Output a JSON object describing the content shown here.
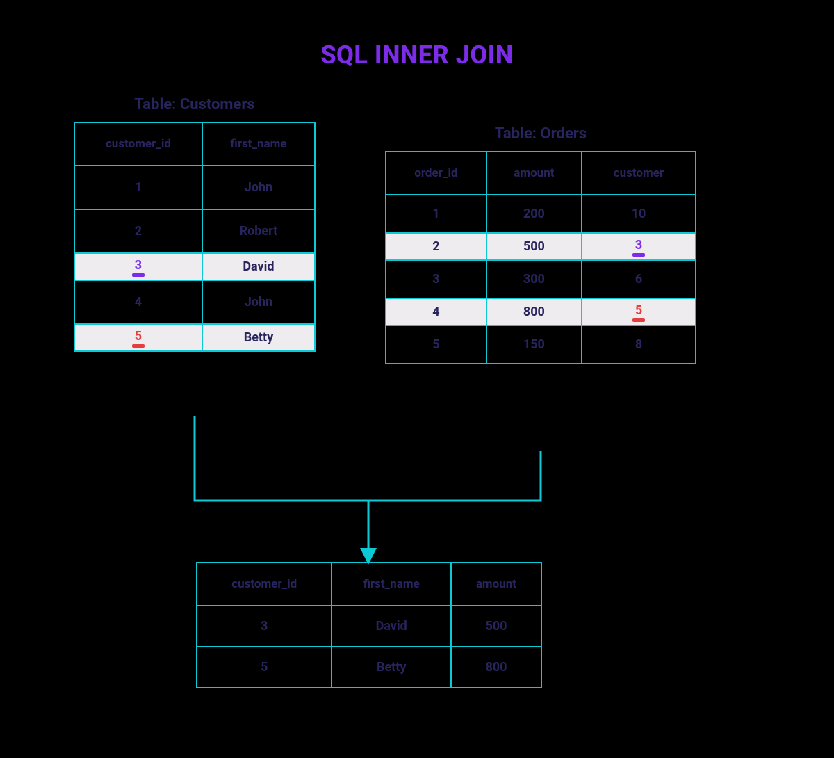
{
  "title": "SQL INNER JOIN",
  "customers": {
    "label": "Table: Customers",
    "headers": [
      "customer_id",
      "first_name"
    ],
    "rows": [
      {
        "cells": [
          "1",
          "John"
        ],
        "highlight": null
      },
      {
        "cells": [
          "2",
          "Robert"
        ],
        "highlight": null
      },
      {
        "cells": [
          "3",
          "David"
        ],
        "highlight": "purple",
        "underline_col": 0
      },
      {
        "cells": [
          "4",
          "John"
        ],
        "highlight": null
      },
      {
        "cells": [
          "5",
          "Betty"
        ],
        "highlight": "red",
        "underline_col": 0
      }
    ]
  },
  "orders": {
    "label": "Table: Orders",
    "headers": [
      "order_id",
      "amount",
      "customer"
    ],
    "rows": [
      {
        "cells": [
          "1",
          "200",
          "10"
        ],
        "highlight": null
      },
      {
        "cells": [
          "2",
          "500",
          "3"
        ],
        "highlight": "purple",
        "underline_col": 2
      },
      {
        "cells": [
          "3",
          "300",
          "6"
        ],
        "highlight": null
      },
      {
        "cells": [
          "4",
          "800",
          "5"
        ],
        "highlight": "red",
        "underline_col": 2
      },
      {
        "cells": [
          "5",
          "150",
          "8"
        ],
        "highlight": null
      }
    ]
  },
  "result": {
    "headers": [
      "customer_id",
      "first_name",
      "amount"
    ],
    "rows": [
      {
        "cells": [
          "3",
          "David",
          "500"
        ]
      },
      {
        "cells": [
          "5",
          "Betty",
          "800"
        ]
      }
    ]
  },
  "colors": {
    "border": "#0cc9d6",
    "text": "#28245e",
    "title": "#7c2ce8",
    "hl_purple": "#7c2ce8",
    "hl_red": "#e53e3e"
  }
}
